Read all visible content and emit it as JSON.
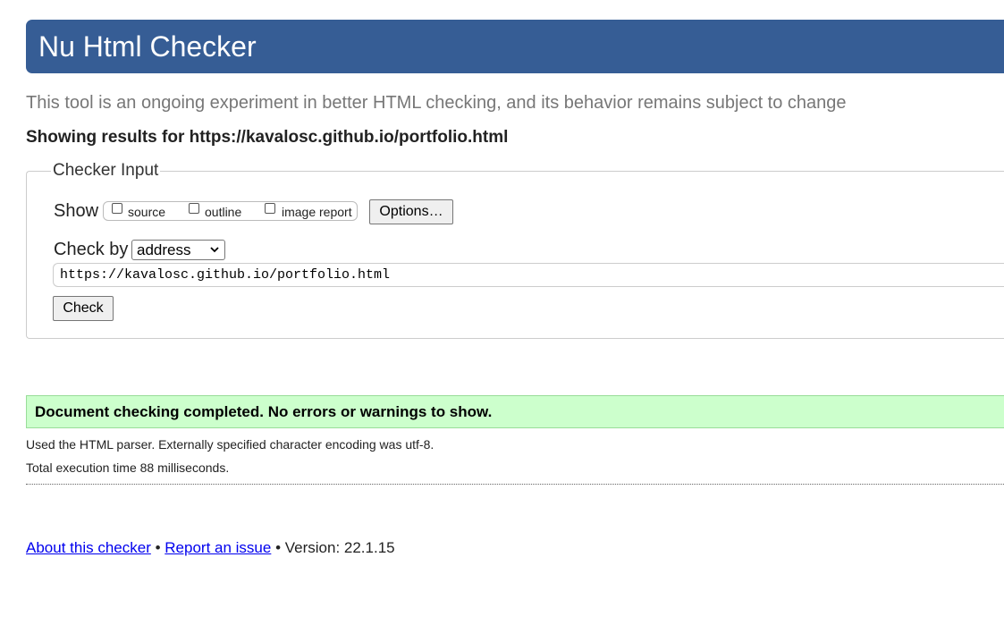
{
  "header": {
    "title": "Nu Html Checker",
    "background_color": "#365d95"
  },
  "subtitle": "This tool is an ongoing experiment in better HTML checking, and its behavior remains subject to change",
  "results_heading": "Showing results for https://kavalosc.github.io/portfolio.html",
  "checker_input": {
    "legend": "Checker Input",
    "show_label": "Show",
    "show_options": [
      {
        "label": "source",
        "checked": false
      },
      {
        "label": "outline",
        "checked": false
      },
      {
        "label": "image report",
        "checked": false
      }
    ],
    "options_button": "Options…",
    "check_by_label": "Check by",
    "check_by_value": "address",
    "url_value": "https://kavalosc.github.io/portfolio.html",
    "check_button": "Check"
  },
  "result": {
    "message": "Document checking completed. No errors or warnings to show.",
    "background_color": "#ccffcc",
    "parser_info": "Used the HTML parser. Externally specified character encoding was utf-8.",
    "execution_time": "Total execution time 88 milliseconds."
  },
  "footer": {
    "about_link": "About this checker",
    "separator_1": " • ",
    "report_link": "Report an issue",
    "separator_2": " • ",
    "version": "Version: 22.1.15"
  },
  "icons": {
    "select_chevron": "chevron-down-icon"
  }
}
